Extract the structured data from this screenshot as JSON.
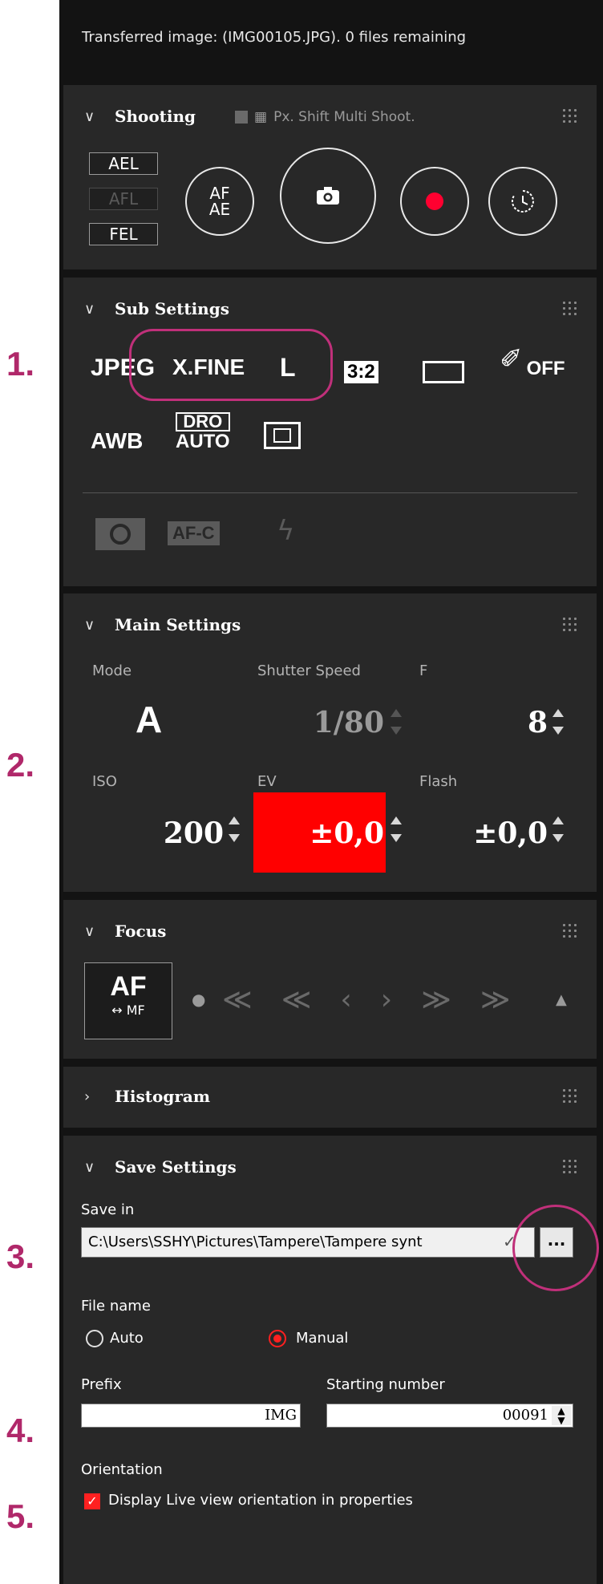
{
  "callouts": [
    "1.",
    "2.",
    "3.",
    "4.",
    "5."
  ],
  "status": {
    "text": "Transferred image: (IMG00105.JPG). 0 files remaining"
  },
  "shooting": {
    "title": "Shooting",
    "px_shift_label": "Px. Shift Multi Shoot.",
    "locks": [
      "AEL",
      "AFL",
      "FEL"
    ],
    "af_ae_top": "AF",
    "af_ae_bottom": "AE"
  },
  "sub_settings": {
    "title": "Sub Settings",
    "file_format": "JPEG",
    "quality": "X.FINE",
    "size": "L",
    "aspect": "3:2",
    "creative_off": "OFF",
    "wb": "AWB",
    "dro_top": "DRO",
    "dro_bottom": "AUTO",
    "afc": "AF-C"
  },
  "main_settings": {
    "title": "Main Settings",
    "mode_label": "Mode",
    "mode_value": "A",
    "shutter_label": "Shutter Speed",
    "shutter_value": "1/80",
    "f_label": "F",
    "f_value": "8",
    "iso_label": "ISO",
    "iso_value": "200",
    "ev_label": "EV",
    "ev_value": "±0,0",
    "flash_label": "Flash",
    "flash_value": "±0,0",
    "ev_highlight": "#ff0000"
  },
  "focus": {
    "title": "Focus",
    "af_label": "AF",
    "mf_label": "↔ MF",
    "arrows": [
      "≪",
      "≪",
      "‹",
      "›",
      "≫",
      "≫"
    ]
  },
  "histogram": {
    "title": "Histogram"
  },
  "save_settings": {
    "title": "Save Settings",
    "save_in_label": "Save in",
    "save_path": "C:\\Users\\SSHY\\Pictures\\Tampere\\Tampere synt",
    "browse_label": "...",
    "file_name_label": "File name",
    "auto_label": "Auto",
    "manual_label": "Manual",
    "prefix_label": "Prefix",
    "prefix_value": "IMG",
    "start_label": "Starting number",
    "start_value": "00091",
    "orientation_label": "Orientation",
    "orientation_checkbox": "Display Live view orientation in properties"
  },
  "colors": {
    "accent": "#ff0000",
    "callout": "#b0286a"
  }
}
